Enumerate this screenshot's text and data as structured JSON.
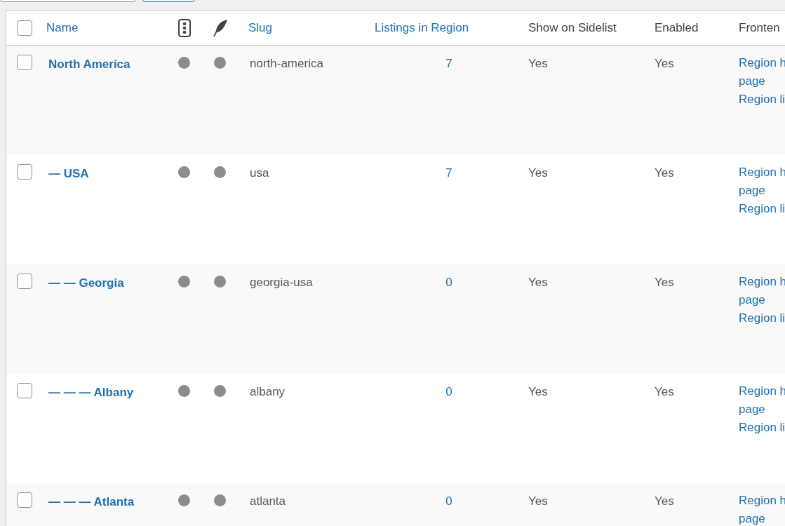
{
  "table": {
    "select_all": {
      "checked": false
    },
    "columns": [
      {
        "label": "Name",
        "sortable": true
      },
      {
        "kind": "icon-dots"
      },
      {
        "kind": "icon-feather"
      },
      {
        "label": "Slug",
        "sortable": true
      },
      {
        "label": "Listings in Region",
        "sortable": true
      },
      {
        "label": "Show on Sidelist",
        "sortable": false
      },
      {
        "label": "Enabled",
        "sortable": false
      },
      {
        "label": "Fronten",
        "sortable": false
      }
    ],
    "rows": [
      {
        "checked": false,
        "name": "North America",
        "slug": "north-america",
        "listings": "7",
        "sidelist": "Yes",
        "enabled": "Yes",
        "links": [
          [
            "Region h",
            "page"
          ],
          [
            "Region li"
          ]
        ]
      },
      {
        "checked": false,
        "name": "— USA",
        "slug": "usa",
        "listings": "7",
        "sidelist": "Yes",
        "enabled": "Yes",
        "links": [
          [
            "Region h",
            "page"
          ],
          [
            "Region li"
          ]
        ]
      },
      {
        "checked": false,
        "name": "— — Georgia",
        "slug": "georgia-usa",
        "listings": "0",
        "sidelist": "Yes",
        "enabled": "Yes",
        "links": [
          [
            "Region h",
            "page"
          ],
          [
            "Region li"
          ]
        ]
      },
      {
        "checked": false,
        "name": "— — — Albany",
        "slug": "albany",
        "listings": "0",
        "sidelist": "Yes",
        "enabled": "Yes",
        "links": [
          [
            "Region h",
            "page"
          ],
          [
            "Region li"
          ]
        ]
      },
      {
        "checked": false,
        "name": "— — — Atlanta",
        "slug": "atlanta",
        "listings": "0",
        "sidelist": "Yes",
        "enabled": "Yes",
        "links": [
          [
            "Region h",
            "page"
          ]
        ]
      }
    ]
  }
}
